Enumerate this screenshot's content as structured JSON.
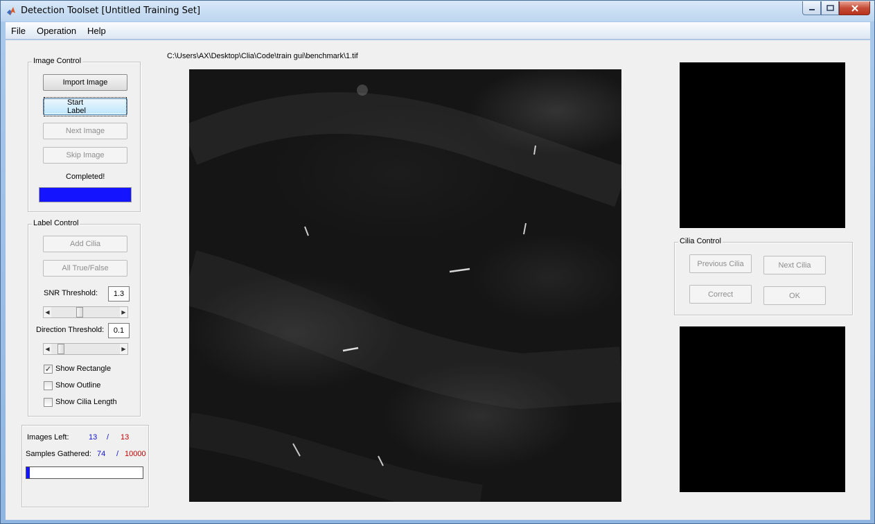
{
  "window": {
    "title": "Detection Toolset  [Untitled Training Set]"
  },
  "menu": {
    "items": [
      "File",
      "Operation",
      "Help"
    ]
  },
  "image_control": {
    "title": "Image Control",
    "import_label": "Import Image",
    "start_label": "Start Label",
    "next_label": "Next Image",
    "skip_label": "Skip Image",
    "status": "Completed!",
    "progress": 1.0,
    "progress_color": "#1414ff"
  },
  "label_control": {
    "title": "Label Control",
    "add_cilia_label": "Add Cilia",
    "all_true_false_label": "All True/False",
    "snr_label": "SNR Threshold:",
    "snr_value": "1.3",
    "snr_slider_value": 0.4,
    "direction_label": "Direction Threshold:",
    "direction_value": "0.1",
    "direction_slider_value": 0.1,
    "show_rectangle": {
      "label": "Show Rectangle",
      "checked": true
    },
    "show_outline": {
      "label": "Show Outline",
      "checked": false
    },
    "show_cilia_length": {
      "label": "Show Cilia Length",
      "checked": false
    }
  },
  "stats": {
    "images_left_label": "Images Left:",
    "images_left": "13",
    "images_sep": "/",
    "images_total": "13",
    "samples_label": "Samples Gathered:",
    "samples": "74",
    "samples_sep": "/",
    "samples_total": "10000",
    "samples_progress": 0.0074
  },
  "image_view": {
    "path": "C:\\Users\\AX\\Desktop\\Clia\\Code\\train gui\\benchmark\\1.tif"
  },
  "cilia_control": {
    "title": "Cilia Control",
    "previous_label": "Previous Cilia",
    "next_label": "Next Cilia",
    "correct_label": "Correct",
    "ok_label": "OK"
  },
  "colors": {
    "blue_numbers": "#1010d0",
    "red_numbers": "#c00000",
    "progress_fill": "#1414ff"
  }
}
